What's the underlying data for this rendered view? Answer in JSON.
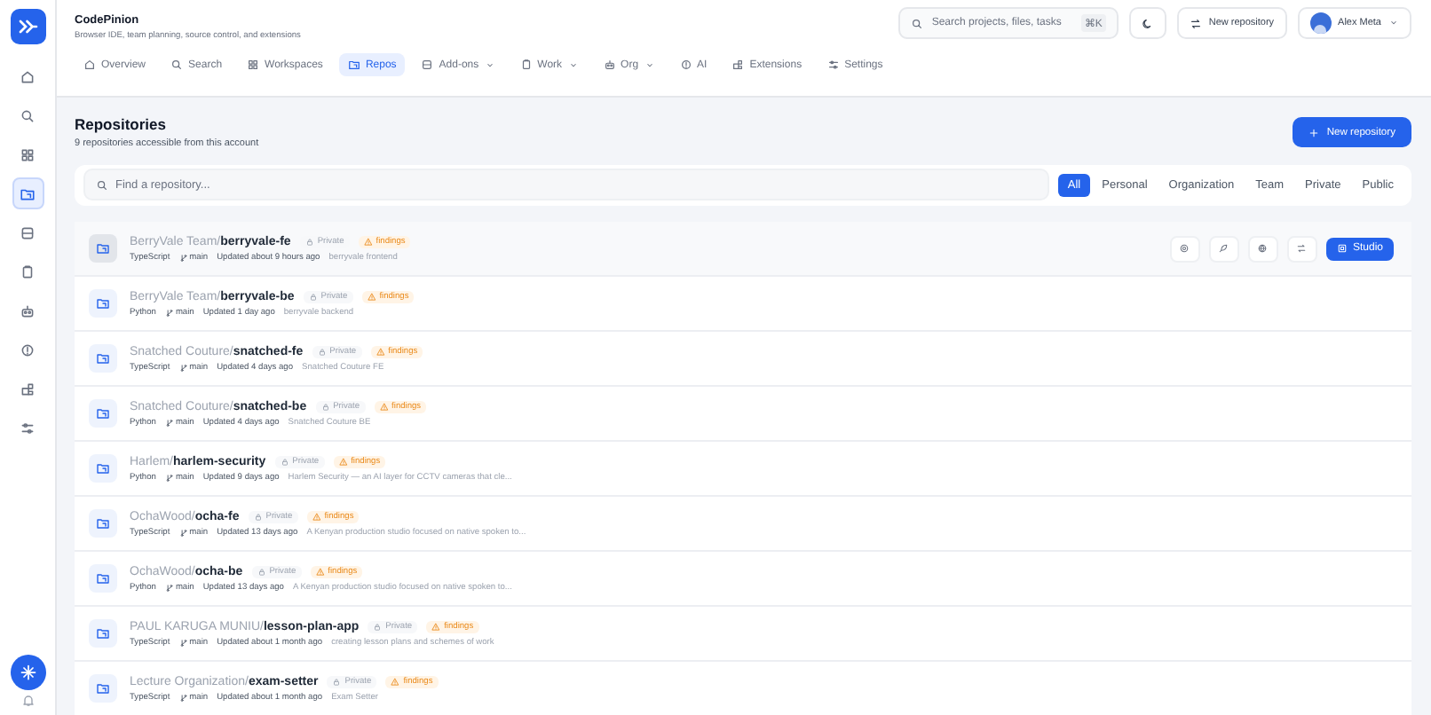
{
  "sidebar": {
    "items": [
      {
        "kind": "home",
        "selected": false
      },
      {
        "kind": "search",
        "selected": false
      },
      {
        "kind": "grid",
        "selected": false
      },
      {
        "kind": "repo",
        "selected": true
      },
      {
        "kind": "database",
        "selected": false
      },
      {
        "kind": "clipboard",
        "selected": false
      },
      {
        "kind": "robot",
        "selected": false
      },
      {
        "kind": "info",
        "selected": false
      },
      {
        "kind": "puzzle",
        "selected": false
      },
      {
        "kind": "sliders",
        "selected": false
      }
    ]
  },
  "app": {
    "name": "CodePinion",
    "tagline": "Browser IDE, team planning, source control, and extensions"
  },
  "nav": [
    {
      "label": "Overview",
      "kind": "home",
      "selected": false,
      "dropdown": false
    },
    {
      "label": "Search",
      "kind": "search",
      "selected": false,
      "dropdown": false
    },
    {
      "label": "Workspaces",
      "kind": "grid",
      "selected": false,
      "dropdown": false
    },
    {
      "label": "Repos",
      "kind": "repo",
      "selected": true,
      "dropdown": false
    },
    {
      "label": "Add-ons",
      "kind": "database",
      "selected": false,
      "dropdown": true
    },
    {
      "label": "Work",
      "kind": "clipboard",
      "selected": false,
      "dropdown": true
    },
    {
      "label": "Org",
      "kind": "robot",
      "selected": false,
      "dropdown": true
    },
    {
      "label": "AI",
      "kind": "info",
      "selected": false,
      "dropdown": false
    },
    {
      "label": "Extensions",
      "kind": "puzzle",
      "selected": false,
      "dropdown": false
    },
    {
      "label": "Settings",
      "kind": "sliders",
      "selected": false,
      "dropdown": false
    }
  ],
  "header": {
    "search": {
      "placeholder": "Search projects, files, tasks",
      "shortcut": "⌘K"
    },
    "new_repository": "New repository",
    "user": "Alex Meta"
  },
  "page": {
    "title": "Repositories",
    "subtitle": "9 repositories accessible from this account",
    "new_repository": "New repository"
  },
  "filter": {
    "placeholder": "Find a repository...",
    "tabs": [
      {
        "label": "All",
        "selected": true
      },
      {
        "label": "Personal",
        "selected": false
      },
      {
        "label": "Organization",
        "selected": false
      },
      {
        "label": "Team",
        "selected": false
      },
      {
        "label": "Private",
        "selected": false
      },
      {
        "label": "Public",
        "selected": false
      }
    ]
  },
  "repositories": {
    "action_label": "Studio",
    "rows": [
      {
        "owner": "BerryVale Team/",
        "name": "berryvale-fe",
        "visibility": "Private",
        "badge": "findings",
        "language": "TypeScript",
        "branch": "main",
        "updated": "Updated about 9 hours ago",
        "description": "berryvale frontend",
        "selected": true
      },
      {
        "owner": "BerryVale Team/",
        "name": "berryvale-be",
        "visibility": "Private",
        "badge": "findings",
        "language": "Python",
        "branch": "main",
        "updated": "Updated 1 day ago",
        "description": "berryvale backend",
        "selected": false
      },
      {
        "owner": "Snatched Couture/",
        "name": "snatched-fe",
        "visibility": "Private",
        "badge": "findings",
        "language": "TypeScript",
        "branch": "main",
        "updated": "Updated 4 days ago",
        "description": "Snatched Couture FE",
        "selected": false
      },
      {
        "owner": "Snatched Couture/",
        "name": "snatched-be",
        "visibility": "Private",
        "badge": "findings",
        "language": "Python",
        "branch": "main",
        "updated": "Updated 4 days ago",
        "description": "Snatched Couture BE",
        "selected": false
      },
      {
        "owner": "Harlem/",
        "name": "harlem-security",
        "visibility": "Private",
        "badge": "findings",
        "language": "Python",
        "branch": "main",
        "updated": "Updated 9 days ago",
        "description": "Harlem Security — an AI layer for CCTV cameras that cle...",
        "selected": false
      },
      {
        "owner": "OchaWood/",
        "name": "ocha-fe",
        "visibility": "Private",
        "badge": "findings",
        "language": "TypeScript",
        "branch": "main",
        "updated": "Updated 13 days ago",
        "description": "A Kenyan production studio focused on native spoken to...",
        "selected": false
      },
      {
        "owner": "OchaWood/",
        "name": "ocha-be",
        "visibility": "Private",
        "badge": "findings",
        "language": "Python",
        "branch": "main",
        "updated": "Updated 13 days ago",
        "description": "A Kenyan production studio focused on native spoken to...",
        "selected": false
      },
      {
        "owner": "PAUL KARUGA MUNIU/",
        "name": "lesson-plan-app",
        "visibility": "Private",
        "badge": "findings",
        "language": "TypeScript",
        "branch": "main",
        "updated": "Updated about 1 month ago",
        "description": "creating lesson plans and schemes of work",
        "selected": false
      },
      {
        "owner": "Lecture Organization/",
        "name": "exam-setter",
        "visibility": "Private",
        "badge": "findings",
        "language": "TypeScript",
        "branch": "main",
        "updated": "Updated about 1 month ago",
        "description": "Exam Setter",
        "selected": false
      }
    ]
  }
}
